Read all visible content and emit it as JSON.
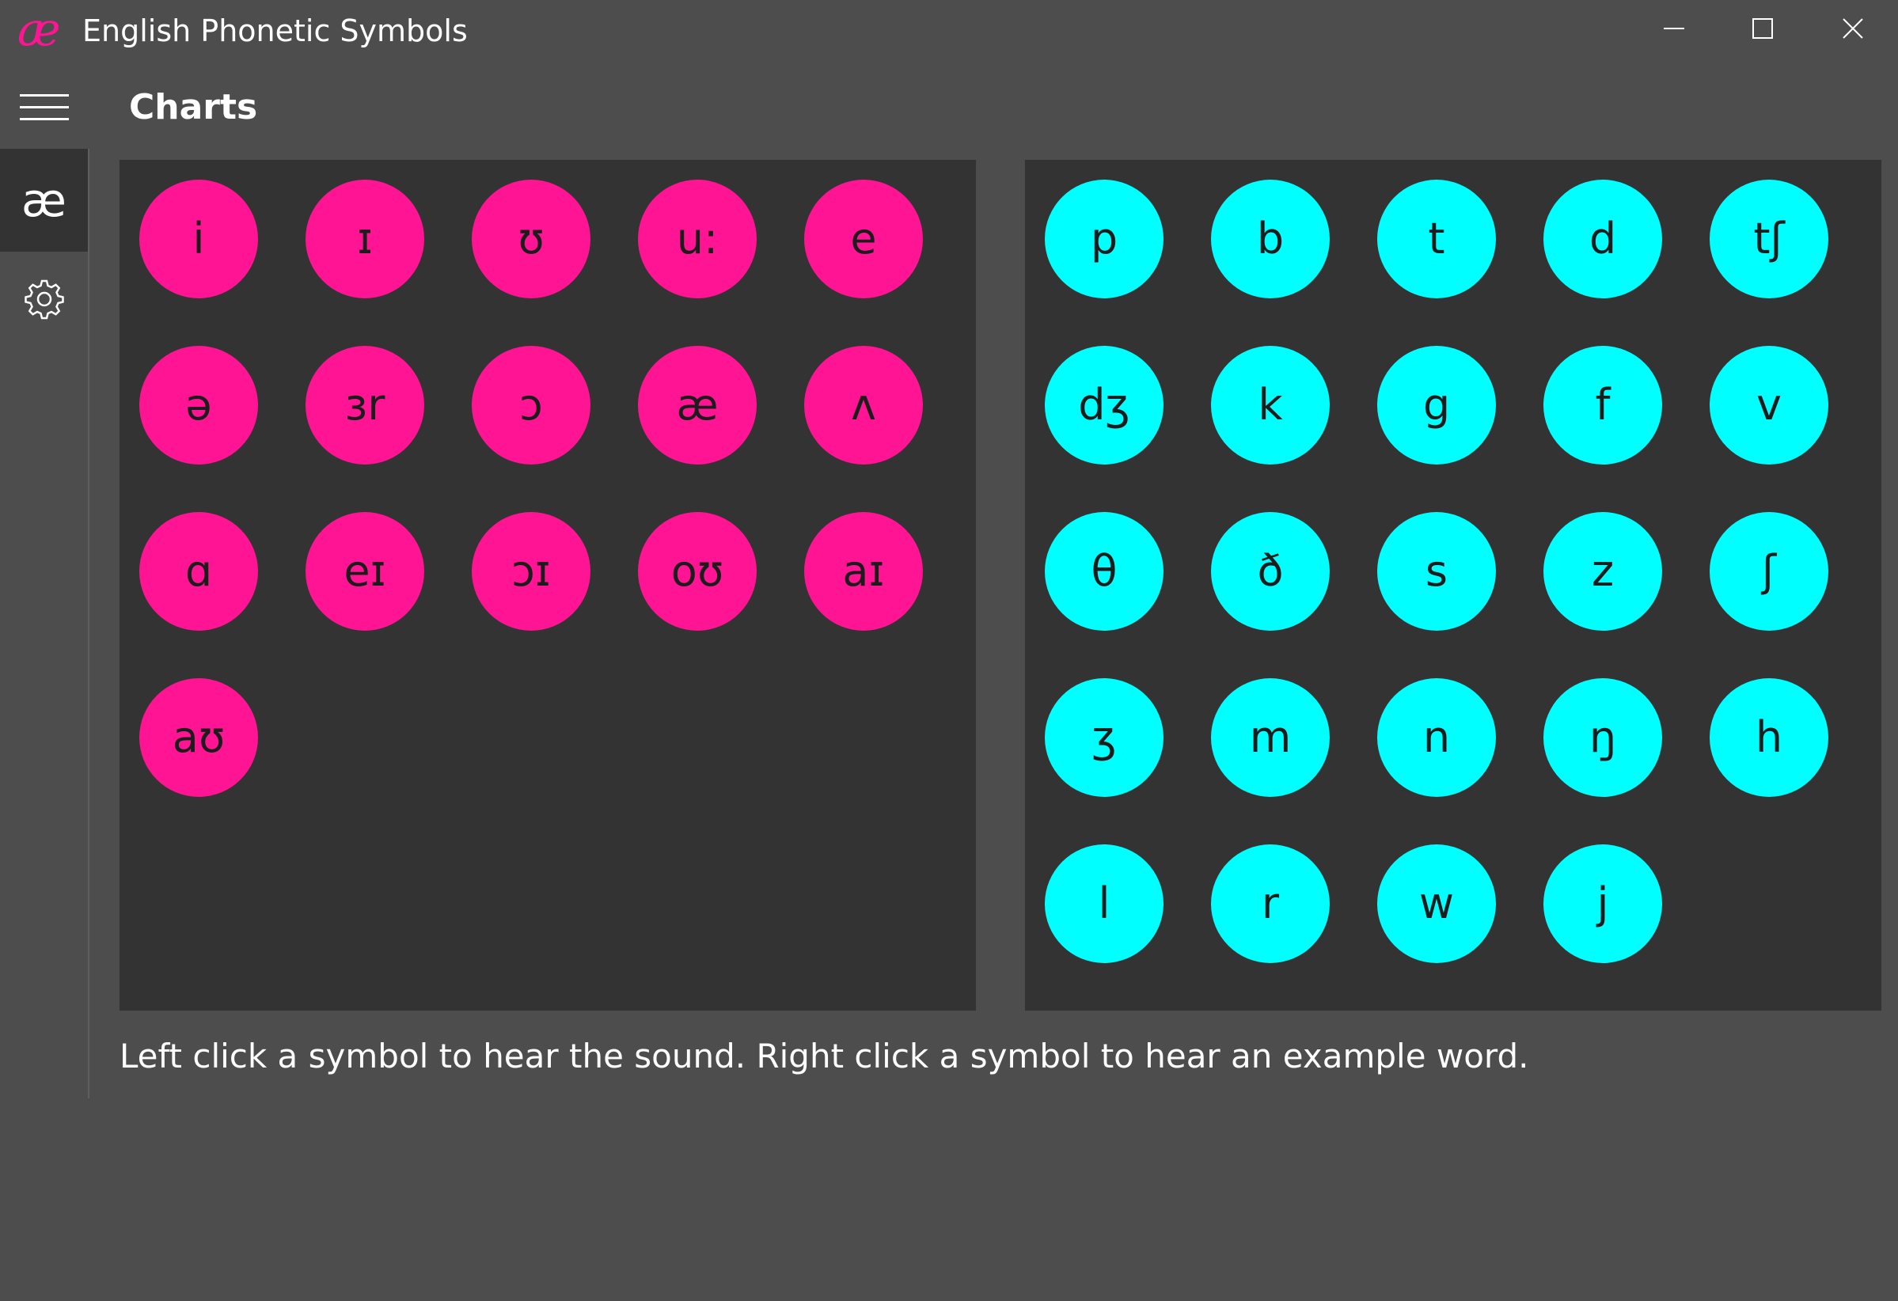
{
  "window": {
    "logo": "æ",
    "title": "English Phonetic Symbols"
  },
  "header": {
    "title": "Charts"
  },
  "nav": {
    "charts_label": "æ",
    "settings_icon": "gear-icon"
  },
  "colors": {
    "vowel": "#ff1493",
    "consonant": "#00ffff",
    "panel": "#333333",
    "background": "#4d4d4d"
  },
  "vowels": [
    "i",
    "ɪ",
    "ʊ",
    "u:",
    "e",
    "ə",
    "ɜr",
    "ɔ",
    "æ",
    "ʌ",
    "ɑ",
    "eɪ",
    "ɔɪ",
    "oʊ",
    "aɪ",
    "aʊ"
  ],
  "consonants": [
    "p",
    "b",
    "t",
    "d",
    "tʃ",
    "dʒ",
    "k",
    "g",
    "f",
    "v",
    "θ",
    "ð",
    "s",
    "z",
    "ʃ",
    "ʒ",
    "m",
    "n",
    "ŋ",
    "h",
    "l",
    "r",
    "w",
    "j"
  ],
  "footer": {
    "instructions": "Left click a symbol to hear the sound. Right click a symbol to hear an example word."
  }
}
